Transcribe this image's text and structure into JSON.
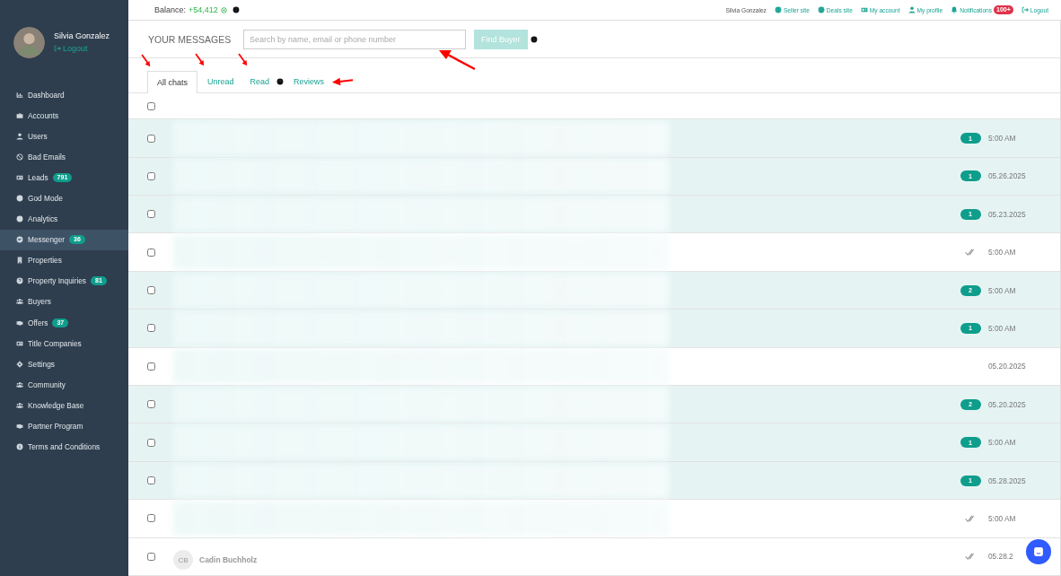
{
  "user": {
    "name": "Silvia Gonzalez",
    "logout": "Logout"
  },
  "sidebar": {
    "items": [
      {
        "label": "Dashboard",
        "selected": false
      },
      {
        "label": "Accounts",
        "selected": false
      },
      {
        "label": "Users",
        "selected": false
      },
      {
        "label": "Bad Emails",
        "selected": false
      },
      {
        "label": "Leads",
        "badge": "791",
        "selected": false
      },
      {
        "label": "God Mode",
        "selected": false
      },
      {
        "label": "Analytics",
        "selected": false
      },
      {
        "label": "Messenger",
        "badge": "36",
        "selected": true
      },
      {
        "label": "Properties",
        "selected": false
      },
      {
        "label": "Property Inquiries",
        "badge": "81",
        "selected": false
      },
      {
        "label": "Buyers",
        "selected": false
      },
      {
        "label": "Offers",
        "badge": "37",
        "selected": false
      },
      {
        "label": "Title Companies",
        "selected": false
      },
      {
        "label": "Settings",
        "selected": false
      },
      {
        "label": "Community",
        "selected": false
      },
      {
        "label": "Knowledge Base",
        "selected": false
      },
      {
        "label": "Partner Program",
        "selected": false
      },
      {
        "label": "Terms and Conditions",
        "selected": false
      }
    ]
  },
  "topbar": {
    "balance_label": "Balance:",
    "balance": "+54,412",
    "user": "Silvia Gonzalez",
    "links": [
      {
        "label": "Seller site"
      },
      {
        "label": "Deals site"
      },
      {
        "label": "My account"
      },
      {
        "label": "My profile"
      },
      {
        "label": "Notifications",
        "badge": "100+"
      },
      {
        "label": "Logout"
      }
    ]
  },
  "header": {
    "title": "YOUR MESSAGES",
    "search": {
      "placeholder": "Search by name, email or phone number",
      "highlighted": true
    },
    "button": "Find Buyer"
  },
  "tabs": [
    {
      "label": "All chats",
      "selected": true,
      "highlighted": true,
      "help": false
    },
    {
      "label": "Unread",
      "selected": false,
      "highlighted": true,
      "help": false
    },
    {
      "label": "Read",
      "selected": false,
      "highlighted": true,
      "help": true
    },
    {
      "label": "Reviews",
      "selected": false,
      "highlighted": true,
      "help": false
    }
  ],
  "select_all": {
    "checked": false
  },
  "rows": [
    {
      "checked": false,
      "unread": true,
      "badge": "1",
      "time": "5:00 AM"
    },
    {
      "checked": false,
      "unread": true,
      "badge": "1",
      "time": "05.26.2025"
    },
    {
      "checked": false,
      "unread": true,
      "badge": "1",
      "time": "05.23.2025"
    },
    {
      "checked": false,
      "unread": false,
      "seen": true,
      "time": "5:00 AM"
    },
    {
      "checked": false,
      "unread": true,
      "badge": "2",
      "time": "5:00 AM"
    },
    {
      "checked": false,
      "unread": true,
      "badge": "1",
      "time": "5:00 AM"
    },
    {
      "checked": false,
      "unread": false,
      "seen": false,
      "time": "05.20.2025"
    },
    {
      "checked": false,
      "unread": true,
      "badge": "2",
      "time": "05.20.2025"
    },
    {
      "checked": false,
      "unread": true,
      "badge": "1",
      "time": "5:00 AM"
    },
    {
      "checked": false,
      "unread": true,
      "badge": "1",
      "time": "05.28.2025"
    },
    {
      "checked": false,
      "unread": false,
      "seen": true,
      "time": "5:00 AM"
    },
    {
      "checked": false,
      "unread": false,
      "seen": true,
      "time": "05.28.2",
      "initials": "CB",
      "name": "Cadin Buchholz"
    }
  ]
}
